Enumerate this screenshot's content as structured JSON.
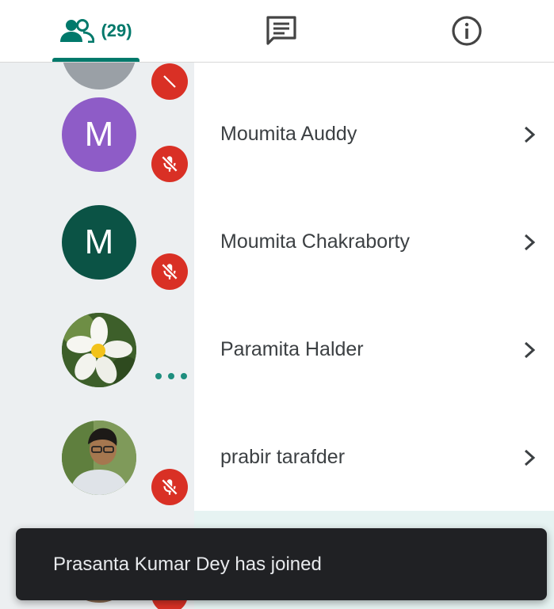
{
  "tabs": {
    "people_count": "(29)",
    "people_icon": "people-icon",
    "chat_icon": "chat-icon",
    "info_icon": "info-icon"
  },
  "colors": {
    "accent": "#00796b",
    "mute_badge": "#d93025",
    "avatar_purple": "#8e5cc7",
    "avatar_green": "#0b5345",
    "toast_bg": "#202124"
  },
  "participants": [
    {
      "name": "Moumita Auddy",
      "avatar_letter": "M",
      "status": "muted"
    },
    {
      "name": "Moumita Chakraborty",
      "avatar_letter": "M",
      "status": "muted"
    },
    {
      "name": "Paramita Halder",
      "avatar_letter": "",
      "status": "more-options"
    },
    {
      "name": "prabir tarafder",
      "avatar_letter": "",
      "status": "muted"
    }
  ],
  "toast": {
    "message": "Prasanta Kumar Dey has joined"
  }
}
